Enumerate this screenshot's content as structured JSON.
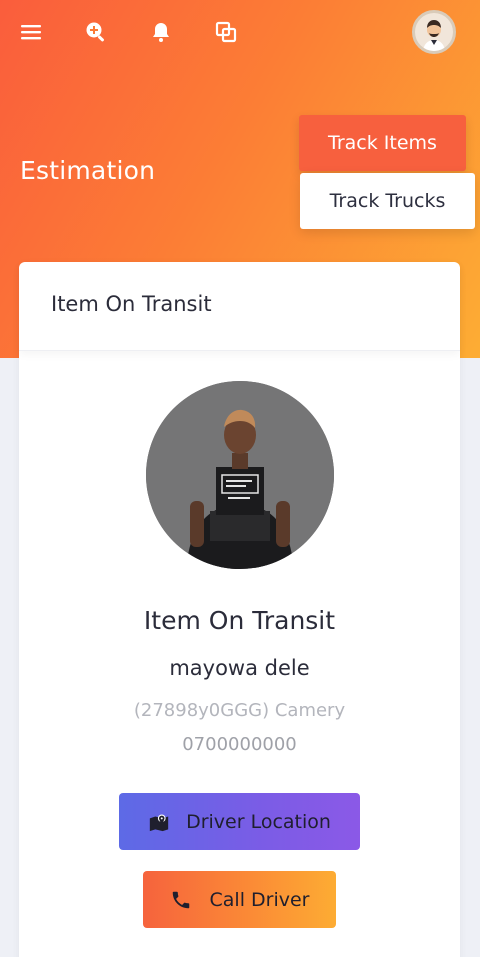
{
  "header": {
    "page_title": "Estimation",
    "icons": [
      "menu-icon",
      "zoom-in-icon",
      "bell-icon",
      "copy-icon"
    ]
  },
  "tabs": {
    "track_items": "Track Items",
    "track_trucks": "Track Trucks"
  },
  "card": {
    "header_title": "Item On Transit",
    "status_title": "Item On Transit",
    "driver_name": "mayowa dele",
    "vehicle": "(27898y0GGG) Camery",
    "phone": "0700000000",
    "driver_location_label": "Driver Location",
    "call_driver_label": "Call Driver"
  },
  "colors": {
    "header_gradient_start": "#fa5d3c",
    "header_gradient_end": "#fdad34",
    "track_items_bg": "#f7603e",
    "location_button_start": "#5d6ae6",
    "location_button_end": "#8b59e7",
    "call_button_start": "#f6633d",
    "call_button_end": "#fdac33"
  }
}
